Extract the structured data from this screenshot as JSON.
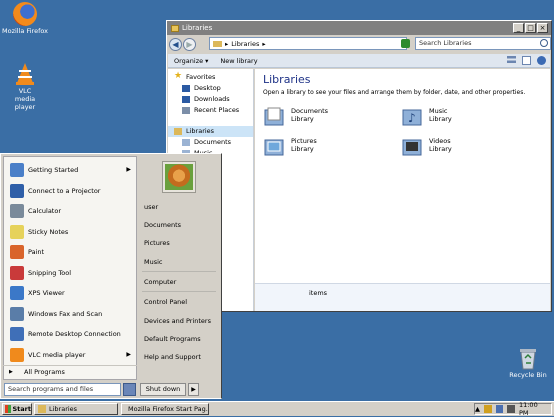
{
  "desktop": {
    "icons": [
      {
        "label": "Mozilla Firefox"
      },
      {
        "label": "VLC media player"
      },
      {
        "label": "Recycle Bin"
      }
    ]
  },
  "explorer": {
    "title": "Libraries",
    "address": "Libraries",
    "search_placeholder": "Search Libraries",
    "toolbar": {
      "organize": "Organize",
      "new_library": "New library"
    },
    "nav": {
      "favorites": "Favorites",
      "desktop": "Desktop",
      "downloads": "Downloads",
      "recent_places": "Recent Places",
      "libraries": "Libraries",
      "documents": "Documents",
      "music": "Music"
    },
    "heading": "Libraries",
    "subtitle": "Open a library to see your files and arrange them by folder, date, and other properties.",
    "libraries": [
      {
        "name": "Documents",
        "type": "Library"
      },
      {
        "name": "Music",
        "type": "Library"
      },
      {
        "name": "Pictures",
        "type": "Library"
      },
      {
        "name": "Videos",
        "type": "Library"
      }
    ],
    "details": "items"
  },
  "start_menu": {
    "programs": [
      {
        "label": "Getting Started",
        "has_arrow": true
      },
      {
        "label": "Connect to a Projector"
      },
      {
        "label": "Calculator"
      },
      {
        "label": "Sticky Notes"
      },
      {
        "label": "Paint"
      },
      {
        "label": "Snipping Tool"
      },
      {
        "label": "XPS Viewer"
      },
      {
        "label": "Windows Fax and Scan"
      },
      {
        "label": "Remote Desktop Connection"
      },
      {
        "label": "VLC media player",
        "has_arrow": true
      }
    ],
    "all_programs": "All Programs",
    "search_placeholder": "Search programs and files",
    "places": {
      "user": "user",
      "documents": "Documents",
      "pictures": "Pictures",
      "music": "Music",
      "computer": "Computer",
      "control_panel": "Control Panel",
      "devices_printers": "Devices and Printers",
      "default_programs": "Default Programs",
      "help_support": "Help and Support"
    },
    "shutdown": "Shut down"
  },
  "taskbar": {
    "start": "Start",
    "buttons": [
      {
        "label": "Libraries"
      },
      {
        "label": "Mozilla Firefox Start Pag..."
      }
    ],
    "clock": "11:00 PM"
  },
  "colors": {
    "desktop": "#3a6ea5",
    "heading": "#1e3287",
    "selection": "#cce4f7"
  }
}
